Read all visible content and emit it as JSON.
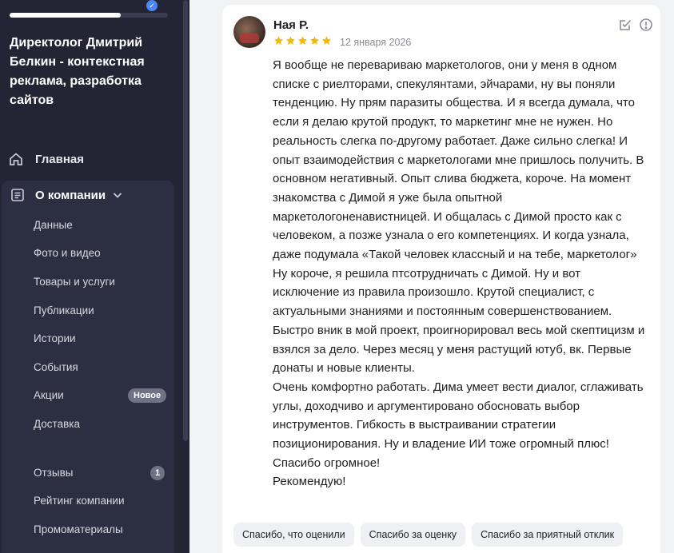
{
  "sidebar": {
    "progress_fraction": 0.7,
    "company_name": "Директолог Дмитрий Белкин - контекстная реклама, разработка сайтов",
    "nav": {
      "home_label": "Главная",
      "company_label": "О компании",
      "items": [
        {
          "label": "Данные"
        },
        {
          "label": "Фото и видео"
        },
        {
          "label": "Товары и услуги"
        },
        {
          "label": "Публикации"
        },
        {
          "label": "Истории"
        },
        {
          "label": "События"
        },
        {
          "label": "Акции",
          "badge": "Новое"
        },
        {
          "label": "Доставка"
        },
        {
          "label": "Отзывы",
          "badge": "1"
        },
        {
          "label": "Рейтинг компании"
        },
        {
          "label": "Промоматериалы"
        }
      ]
    },
    "icons": {
      "verified": "verified-check-icon",
      "home": "home-icon",
      "company": "document-list-icon",
      "chevron": "chevron-down-icon"
    }
  },
  "review": {
    "author": "Ная Р.",
    "rating": 5,
    "rating_max": 5,
    "date": "12 января 2026",
    "star_color": "#f5b800",
    "paragraphs": [
      "Я вообще не перевариваю маркетологов, они у меня в одном списке с риелторами, спекулянтами, эйчарами, ну вы поняли тенденцию. Ну прям паразиты общества. И я всегда думала, что если я делаю крутой продукт, то маркетинг мне не нужен. Но реальность слегка по-другому работает. Даже сильно слегка! И опыт взаимодействия с маркетологами мне пришлось получить. В основном негативный. Опыт слива бюджета, короче. На момент знакомства с Димой я уже была опытной маркетологоненавистницей. И общалась с Димой просто как с человеком, а позже узнала о его компетенциях. И когда узнала, даже подумала «Такой человек классный и на тебе, маркетолог»",
      "Ну короче, я решила птсотрудничать с Димой. Ну и вот исключение из правила произошло. Крутой специалист, с актуальными знаниями и постоянным совершенствованием. Быстро вник в мой проект, проигнорировал весь мой скептицизм и взялся за дело. Через месяц у меня растущий ютуб, вк. Первые донаты и новые клиенты.",
      "Очень комфортно работать. Дима умеет вести диалог, сглаживать углы, доходчиво и аргументировано обосновать выбор инструментов. Гибкость в выстраивании стратегии позиционирования. Ну и владение ИИ тоже огромный плюс!",
      "Спасибо огромное!",
      "Рекомендую!"
    ],
    "action_icons": [
      "edit-checkbox-icon",
      "report-icon"
    ],
    "quick_replies": [
      "Спасибо, что оценили",
      "Спасибо за оценку",
      "Спасибо за приятный отклик"
    ]
  }
}
